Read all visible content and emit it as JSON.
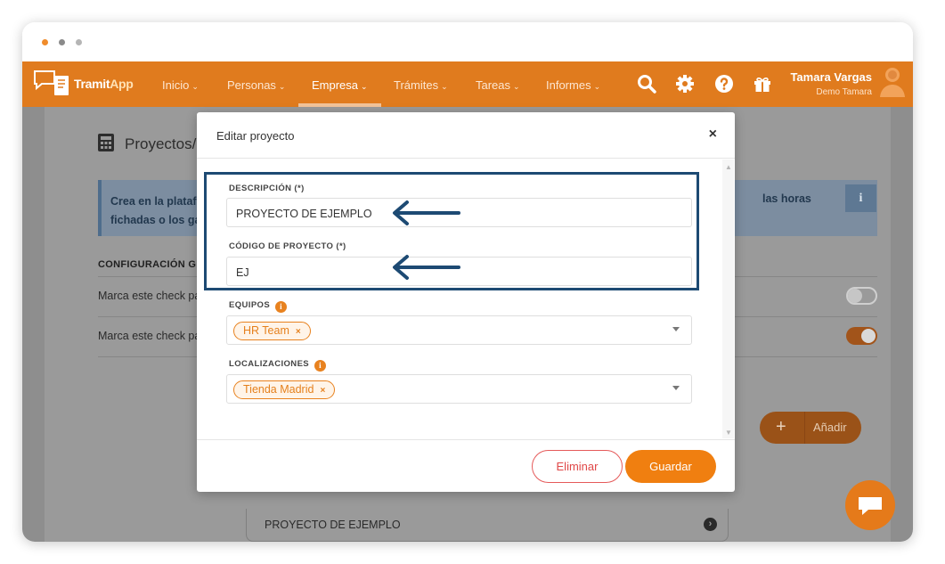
{
  "window": {
    "dots": [
      "#f08c2c",
      "#8a8a8a",
      "#b5b5b5"
    ]
  },
  "navbar": {
    "brand_prefix": "Tramit",
    "brand_suffix": "App",
    "items": [
      {
        "label": "Inicio"
      },
      {
        "label": "Personas"
      },
      {
        "label": "Empresa"
      },
      {
        "label": "Trámites"
      },
      {
        "label": "Tareas"
      },
      {
        "label": "Informes"
      }
    ],
    "active_item": "Empresa",
    "icons": [
      "search-icon",
      "gear-icon",
      "help-icon",
      "gift-icon"
    ],
    "user": {
      "name": "Tamara Vargas",
      "company": "Demo Tamara"
    },
    "colors": {
      "bar": "#e07b1e"
    }
  },
  "background": {
    "title": "Proyectos/Cue",
    "info_text_line1": "Crea en la plataform",
    "info_text_line2": "fichadas o los gastos",
    "info_text_right": "las horas",
    "info_badge": "i",
    "section_title": "CONFIGURACIÓN GENER",
    "rows": [
      {
        "label": "Marca este check para",
        "toggle": "off"
      },
      {
        "label": "Marca este check para",
        "toggle": "on"
      }
    ],
    "add_button": "Añadir",
    "project_item": "PROYECTO DE EJEMPLO"
  },
  "modal": {
    "title": "Editar proyecto",
    "close": "×",
    "fields": {
      "description": {
        "label": "DESCRIPCIÓN (*)",
        "value": "PROYECTO DE EJEMPLO"
      },
      "code": {
        "label": "CÓDIGO DE PROYECTO (*)",
        "value": "EJ"
      },
      "teams": {
        "label": "EQUIPOS",
        "tags": [
          "HR Team"
        ]
      },
      "locations": {
        "label": "LOCALIZACIONES",
        "tags": [
          "Tienda Madrid"
        ]
      }
    },
    "buttons": {
      "delete": "Eliminar",
      "save": "Guardar"
    },
    "colors": {
      "accent": "#f07f10",
      "highlight": "#1d4a73",
      "danger": "#e04848"
    }
  }
}
